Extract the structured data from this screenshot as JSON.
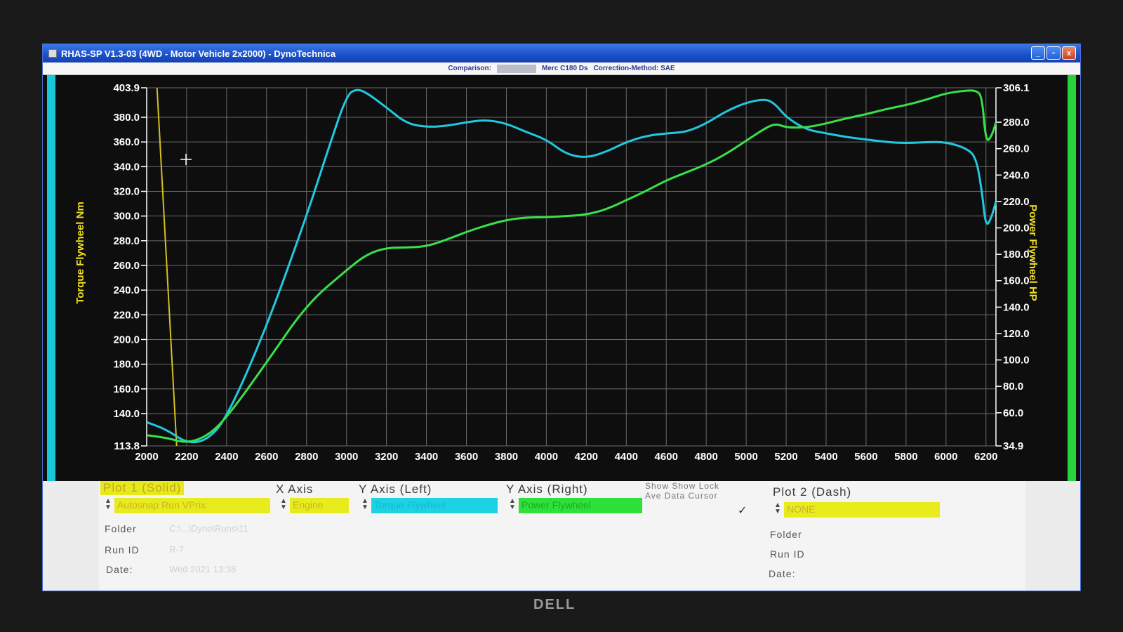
{
  "window": {
    "title": "RHAS-SP V1.3-03  (4WD - Motor Vehicle 2x2000) - DynoTechnica",
    "buttons": [
      "_",
      "▫",
      "x"
    ]
  },
  "comparison_bar": {
    "label": "Comparison:",
    "vehicle": "Merc C180 Ds",
    "correction": "Correction-Method: SAE"
  },
  "chart_data": {
    "type": "line",
    "title": "",
    "xlabel": "",
    "ylabel_left": "Torque Flywheel Nm",
    "ylabel_right": "Power Flywheel HP",
    "xlim": [
      2000,
      6250
    ],
    "ylim_left": [
      113.8,
      403.9
    ],
    "ylim_right": [
      34.9,
      306.1
    ],
    "x_ticks": [
      "2000",
      "2200",
      "2400",
      "2600",
      "2800",
      "3000",
      "3200",
      "3400",
      "3600",
      "3800",
      "4000",
      "4200",
      "4400",
      "4600",
      "4800",
      "5000",
      "5200",
      "5400",
      "5600",
      "5800",
      "6000",
      "6200"
    ],
    "y_left_ticks": [
      "113.8",
      "140.0",
      "160.0",
      "180.0",
      "200.0",
      "220.0",
      "240.0",
      "260.0",
      "280.0",
      "300.0",
      "320.0",
      "340.0",
      "360.0",
      "380.0",
      "403.9"
    ],
    "y_right_ticks": [
      "34.9",
      "60.0",
      "80.0",
      "100.0",
      "120.0",
      "140.0",
      "160.0",
      "180.0",
      "200.0",
      "220.0",
      "240.0",
      "260.0",
      "280.0",
      "306.1"
    ],
    "grid": true,
    "series": [
      {
        "name": "Torque Flywheel",
        "axis": "left",
        "color": "#22c8e0",
        "x": [
          2000,
          2100,
          2200,
          2300,
          2400,
          2600,
          2800,
          2900,
          3000,
          3050,
          3100,
          3200,
          3300,
          3400,
          3500,
          3600,
          3700,
          3800,
          3900,
          4000,
          4100,
          4200,
          4300,
          4400,
          4500,
          4600,
          4700,
          4800,
          4900,
          5000,
          5100,
          5150,
          5200,
          5300,
          5400,
          5500,
          5600,
          5700,
          5800,
          5900,
          6000,
          6100,
          6150,
          6180,
          6200,
          6230,
          6250
        ],
        "y": [
          133,
          127,
          116,
          118,
          136,
          210,
          300,
          350,
          398,
          403,
          400,
          388,
          375,
          372,
          373,
          376,
          378,
          375,
          368,
          362,
          350,
          347,
          352,
          360,
          365,
          367,
          368,
          375,
          385,
          392,
          395,
          390,
          380,
          370,
          367,
          364,
          362,
          360,
          359,
          360,
          360,
          355,
          348,
          320,
          290,
          300,
          312
        ]
      },
      {
        "name": "Power Flywheel",
        "axis": "right",
        "color": "#38e04a",
        "x": [
          2000,
          2100,
          2200,
          2300,
          2400,
          2600,
          2800,
          3000,
          3100,
          3200,
          3300,
          3400,
          3500,
          3600,
          3700,
          3800,
          3900,
          4000,
          4100,
          4200,
          4300,
          4400,
          4500,
          4600,
          4700,
          4800,
          4900,
          5000,
          5100,
          5150,
          5200,
          5300,
          5400,
          5500,
          5600,
          5700,
          5800,
          5900,
          6000,
          6100,
          6150,
          6180,
          6200,
          6230,
          6250
        ],
        "y": [
          43,
          41,
          37,
          42,
          56,
          98,
          142,
          168,
          180,
          185,
          185,
          186,
          191,
          197,
          202,
          206,
          208,
          208,
          209,
          210,
          214,
          221,
          228,
          236,
          242,
          248,
          256,
          266,
          276,
          279,
          276,
          276,
          279,
          283,
          286,
          290,
          293,
          297,
          302,
          304,
          304,
          300,
          264,
          270,
          280
        ]
      }
    ],
    "cursor_line": {
      "x": 2150,
      "color": "#d4c020"
    }
  },
  "panel": {
    "plot1": {
      "header": "Plot 1 (Solid)",
      "source_field": "Autosnap Run VPrix",
      "folder_label": "Folder",
      "folder_value": "C:\\...\\Dyno\\Runs\\11",
      "runid_label": "Run ID",
      "runid_value": "R-7",
      "date_label": "Date:",
      "date_value": "Wed 2021 13:38"
    },
    "x_axis": {
      "header": "X Axis",
      "field": "Engine"
    },
    "y_axis_left": {
      "header": "Y Axis (Left)",
      "field": "Torque Flywheel"
    },
    "y_axis_right": {
      "header": "Y Axis (Right)",
      "field": "Power Flywheel"
    },
    "show": {
      "line1": "Show  Show Lock",
      "line2": "Ave    Data Cursor",
      "check": "✓"
    },
    "plot2": {
      "header": "Plot 2 (Dash)",
      "field": "NONE",
      "folder_label": "Folder",
      "runid_label": "Run ID",
      "date_label": "Date:"
    }
  },
  "monitor_brand": "DELL"
}
